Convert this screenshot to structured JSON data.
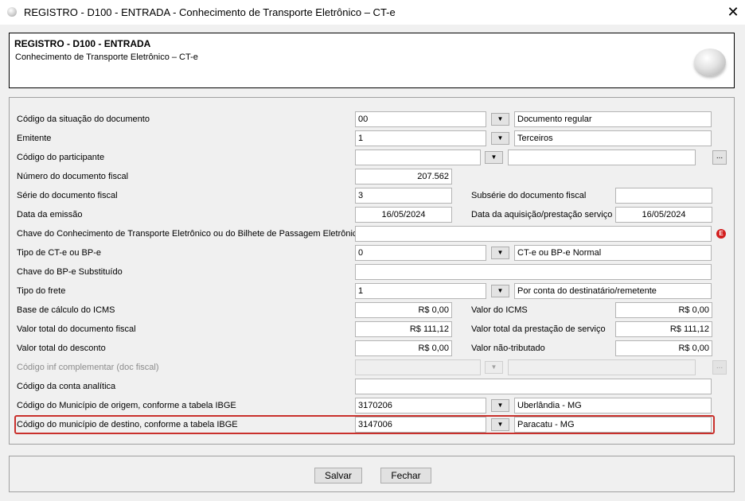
{
  "window": {
    "title": "REGISTRO - D100 - ENTRADA - Conhecimento de Transporte Eletrônico – CT-e",
    "close_glyph": "✕"
  },
  "header": {
    "title": "REGISTRO - D100 - ENTRADA",
    "subtitle": "Conhecimento de Transporte Eletrônico – CT-e"
  },
  "form": {
    "cod_situacao": {
      "label": "Código da situação do documento",
      "code": "00",
      "description": "Documento regular"
    },
    "emitente": {
      "label": "Emitente",
      "code": "1",
      "description": "Terceiros"
    },
    "participante": {
      "label": "Código do participante",
      "code": "",
      "description": ""
    },
    "num_doc": {
      "label": "Número do documento fiscal",
      "value": "207.562"
    },
    "serie": {
      "label": "Série do documento fiscal",
      "value": "3"
    },
    "subserie": {
      "label": "Subsérie do documento fiscal",
      "value": ""
    },
    "data_emissao": {
      "label": "Data da emissão",
      "value": "16/05/2024"
    },
    "data_aquisicao": {
      "label": "Data da aquisição/prestação serviço",
      "value": "16/05/2024"
    },
    "chave_cte": {
      "label": "Chave do Conhecimento de Transporte Eletrônico ou do Bilhete de Passagem Eletrônico",
      "value": ""
    },
    "tipo_cte": {
      "label": "Tipo de CT-e ou BP-e",
      "code": "0",
      "description": "CT-e ou BP-e Normal"
    },
    "chave_bpe": {
      "label": "Chave do BP-e Substituído",
      "value": ""
    },
    "tipo_frete": {
      "label": "Tipo do frete",
      "code": "1",
      "description": "Por conta do destinatário/remetente"
    },
    "base_icms": {
      "label": "Base de cálculo do ICMS",
      "value": "R$ 0,00"
    },
    "valor_icms": {
      "label": "Valor do ICMS",
      "value": "R$ 0,00"
    },
    "valor_total_doc": {
      "label": "Valor total do documento fiscal",
      "value": "R$ 111,12"
    },
    "valor_total_prest": {
      "label": "Valor total da prestação de serviço",
      "value": "R$ 111,12"
    },
    "valor_desconto": {
      "label": "Valor total do desconto",
      "value": "R$ 0,00"
    },
    "valor_nao_trib": {
      "label": "Valor não-tributado",
      "value": "R$ 0,00"
    },
    "cod_inf_compl": {
      "label": "Código inf complementar (doc fiscal)",
      "code": "",
      "description": ""
    },
    "conta_analitica": {
      "label": "Código da conta analítica",
      "value": ""
    },
    "mun_origem": {
      "label": "Código do Município de origem, conforme a tabela IBGE",
      "code": "3170206",
      "description": "Uberlândia - MG"
    },
    "mun_destino": {
      "label": "Código do município de destino, conforme a tabela IBGE",
      "code": "3147006",
      "description": "Paracatu - MG"
    }
  },
  "glyphs": {
    "dropdown": "▼",
    "lookup": "...",
    "warning_badge": "E"
  },
  "buttons": {
    "save": "Salvar",
    "close": "Fechar"
  },
  "colors": {
    "highlight_border": "#c9302c",
    "warning": "#d21f1f"
  }
}
